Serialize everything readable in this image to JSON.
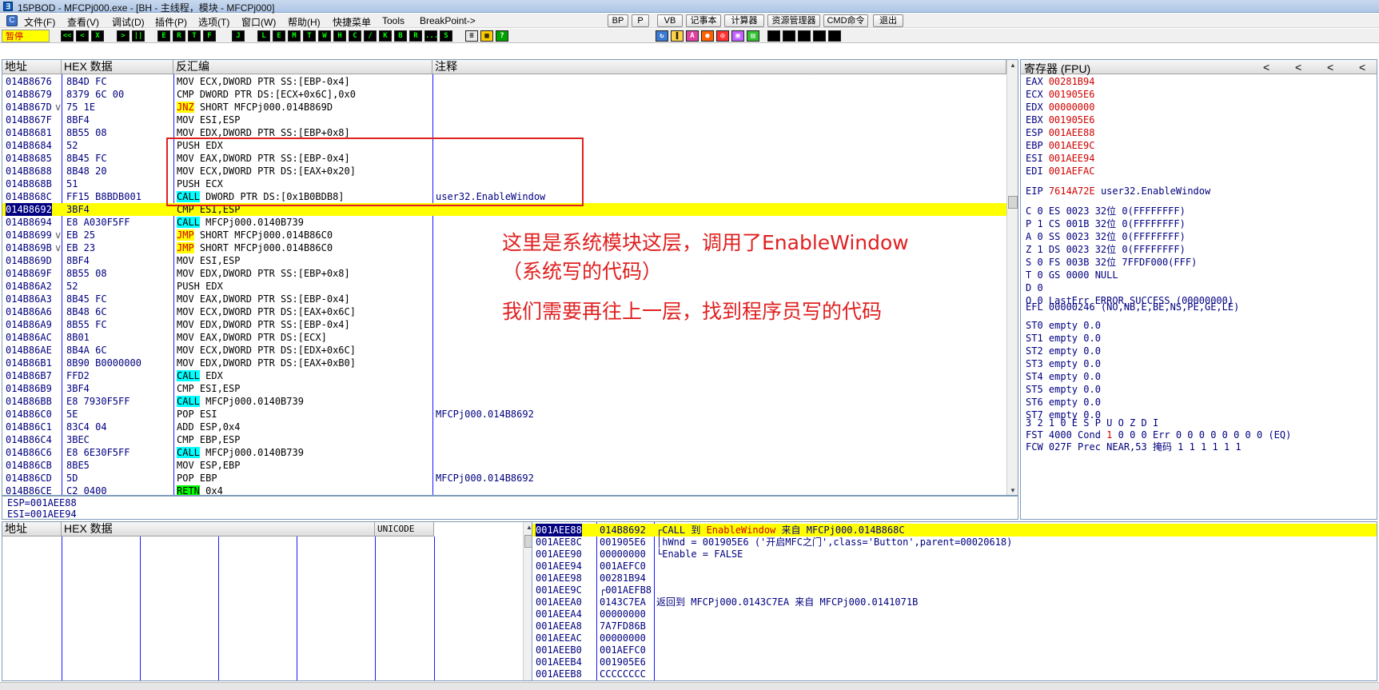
{
  "window": {
    "title": "15PBOD - MFCPj000.exe - [BH - 主线程，模块 - MFCPj000]",
    "icon": "debugger-app-icon"
  },
  "menu": {
    "items": [
      "文件(F)",
      "查看(V)",
      "调试(D)",
      "插件(P)",
      "选项(T)",
      "窗口(W)",
      "帮助(H)",
      "快捷菜单",
      "Tools",
      "BreakPoint->"
    ],
    "buttons": [
      "BP",
      "P",
      "VB",
      "记事本",
      "计算器",
      "资源管理器",
      "CMD命令",
      "退出"
    ]
  },
  "toolbar": {
    "status": "暂停",
    "icons": [
      "<<",
      "<",
      "X",
      ">",
      "||",
      "E",
      "R",
      "T",
      "F",
      "J",
      "L",
      "E",
      "M",
      "T",
      "W",
      "H",
      "C",
      "/",
      "K",
      "B",
      "R",
      "...",
      "S"
    ]
  },
  "disasm": {
    "headers": [
      "地址",
      "HEX 数据",
      "反汇编",
      "注释"
    ],
    "rows": [
      {
        "addr": "014B8676",
        "mark": "",
        "hex": "8B4D FC",
        "op": "",
        "asm": "MOV ECX,DWORD PTR SS:[EBP-0x4]",
        "cmt": ""
      },
      {
        "addr": "014B8679",
        "mark": "",
        "hex": "8379 6C 00",
        "op": "",
        "asm": "CMP DWORD PTR DS:[ECX+0x6C],0x0",
        "cmt": ""
      },
      {
        "addr": "014B867D",
        "mark": "v",
        "hex": "75 1E",
        "op": "JNZ",
        "asm": " SHORT MFCPj000.014B869D",
        "cmt": ""
      },
      {
        "addr": "014B867F",
        "mark": "",
        "hex": "8BF4",
        "op": "",
        "asm": "MOV ESI,ESP",
        "cmt": ""
      },
      {
        "addr": "014B8681",
        "mark": "",
        "hex": "8B55 08",
        "op": "",
        "asm": "MOV EDX,DWORD PTR SS:[EBP+0x8]",
        "cmt": ""
      },
      {
        "addr": "014B8684",
        "mark": "",
        "hex": "52",
        "op": "",
        "asm": "PUSH EDX",
        "cmt": ""
      },
      {
        "addr": "014B8685",
        "mark": "",
        "hex": "8B45 FC",
        "op": "",
        "asm": "MOV EAX,DWORD PTR SS:[EBP-0x4]",
        "cmt": ""
      },
      {
        "addr": "014B8688",
        "mark": "",
        "hex": "8B48 20",
        "op": "",
        "asm": "MOV ECX,DWORD PTR DS:[EAX+0x20]",
        "cmt": ""
      },
      {
        "addr": "014B868B",
        "mark": "",
        "hex": "51",
        "op": "",
        "asm": "PUSH ECX",
        "cmt": ""
      },
      {
        "addr": "014B868C",
        "mark": "",
        "hex": "FF15 B8BDB001",
        "op": "CALL",
        "asm": " DWORD PTR DS:[0x1B0BDB8]",
        "cmt": "user32.EnableWindow"
      },
      {
        "addr": "014B8692",
        "mark": "",
        "hex": "3BF4",
        "op": "",
        "asm": "CMP ESI,ESP",
        "cmt": ""
      },
      {
        "addr": "014B8694",
        "mark": "",
        "hex": "E8 A030F5FF",
        "op": "CALL",
        "asm": " MFCPj000.0140B739",
        "cmt": ""
      },
      {
        "addr": "014B8699",
        "mark": "v",
        "hex": "EB 25",
        "op": "JMP",
        "asm": " SHORT MFCPj000.014B86C0",
        "cmt": ""
      },
      {
        "addr": "014B869B",
        "mark": "v",
        "hex": "EB 23",
        "op": "JMP",
        "asm": " SHORT MFCPj000.014B86C0",
        "cmt": ""
      },
      {
        "addr": "014B869D",
        "mark": "",
        "hex": "8BF4",
        "op": "",
        "asm": "MOV ESI,ESP",
        "cmt": ""
      },
      {
        "addr": "014B869F",
        "mark": "",
        "hex": "8B55 08",
        "op": "",
        "asm": "MOV EDX,DWORD PTR SS:[EBP+0x8]",
        "cmt": ""
      },
      {
        "addr": "014B86A2",
        "mark": "",
        "hex": "52",
        "op": "",
        "asm": "PUSH EDX",
        "cmt": ""
      },
      {
        "addr": "014B86A3",
        "mark": "",
        "hex": "8B45 FC",
        "op": "",
        "asm": "MOV EAX,DWORD PTR SS:[EBP-0x4]",
        "cmt": ""
      },
      {
        "addr": "014B86A6",
        "mark": "",
        "hex": "8B48 6C",
        "op": "",
        "asm": "MOV ECX,DWORD PTR DS:[EAX+0x6C]",
        "cmt": ""
      },
      {
        "addr": "014B86A9",
        "mark": "",
        "hex": "8B55 FC",
        "op": "",
        "asm": "MOV EDX,DWORD PTR SS:[EBP-0x4]",
        "cmt": ""
      },
      {
        "addr": "014B86AC",
        "mark": "",
        "hex": "8B01",
        "op": "",
        "asm": "MOV EAX,DWORD PTR DS:[ECX]",
        "cmt": ""
      },
      {
        "addr": "014B86AE",
        "mark": "",
        "hex": "8B4A 6C",
        "op": "",
        "asm": "MOV ECX,DWORD PTR DS:[EDX+0x6C]",
        "cmt": ""
      },
      {
        "addr": "014B86B1",
        "mark": "",
        "hex": "8B90 B0000000",
        "op": "",
        "asm": "MOV EDX,DWORD PTR DS:[EAX+0xB0]",
        "cmt": ""
      },
      {
        "addr": "014B86B7",
        "mark": "",
        "hex": "FFD2",
        "op": "CALL",
        "asm": " EDX",
        "cmt": ""
      },
      {
        "addr": "014B86B9",
        "mark": "",
        "hex": "3BF4",
        "op": "",
        "asm": "CMP ESI,ESP",
        "cmt": ""
      },
      {
        "addr": "014B86BB",
        "mark": "",
        "hex": "E8 7930F5FF",
        "op": "CALL",
        "asm": " MFCPj000.0140B739",
        "cmt": ""
      },
      {
        "addr": "014B86C0",
        "mark": "",
        "hex": "5E",
        "op": "",
        "asm": "POP ESI",
        "cmt": "MFCPj000.014B8692"
      },
      {
        "addr": "014B86C1",
        "mark": "",
        "hex": "83C4 04",
        "op": "",
        "asm": "ADD ESP,0x4",
        "cmt": ""
      },
      {
        "addr": "014B86C4",
        "mark": "",
        "hex": "3BEC",
        "op": "",
        "asm": "CMP EBP,ESP",
        "cmt": ""
      },
      {
        "addr": "014B86C6",
        "mark": "",
        "hex": "E8 6E30F5FF",
        "op": "CALL",
        "asm": " MFCPj000.0140B739",
        "cmt": ""
      },
      {
        "addr": "014B86CB",
        "mark": "",
        "hex": "8BE5",
        "op": "",
        "asm": "MOV ESP,EBP",
        "cmt": ""
      },
      {
        "addr": "014B86CD",
        "mark": "",
        "hex": "5D",
        "op": "",
        "asm": "POP EBP",
        "cmt": "MFCPj000.014B8692"
      },
      {
        "addr": "014B86CE",
        "mark": "",
        "hex": "C2 0400",
        "op": "RETN",
        "asm": " 0x4",
        "cmt": ""
      }
    ],
    "current_row_index": 10
  },
  "annotation": {
    "line1": "这里是系统模块这层，调用了EnableWindow",
    "line2": "（系统写的代码）",
    "line3": "我们需要再往上一层，找到程序员写的代码"
  },
  "info": {
    "line1": "ESP=001AEE88",
    "line2": "ESI=001AEE94"
  },
  "registers": {
    "title": "寄存器 (FPU)",
    "nav": [
      "<",
      "<",
      "<",
      "<"
    ],
    "general": [
      {
        "name": "EAX",
        "value": "00281B94"
      },
      {
        "name": "ECX",
        "value": "001905E6"
      },
      {
        "name": "EDX",
        "value": "00000000"
      },
      {
        "name": "EBX",
        "value": "001905E6"
      },
      {
        "name": "ESP",
        "value": "001AEE88"
      },
      {
        "name": "EBP",
        "value": "001AEE9C"
      },
      {
        "name": "ESI",
        "value": "001AEE94"
      },
      {
        "name": "EDI",
        "value": "001AEFAC"
      }
    ],
    "eip": {
      "name": "EIP",
      "value": "7614A72E",
      "sym": "user32.EnableWindow"
    },
    "flags": [
      "C 0  ES 0023 32位 0(FFFFFFFF)",
      "P 1  CS 001B 32位 0(FFFFFFFF)",
      "A 0  SS 0023 32位 0(FFFFFFFF)",
      "Z 1  DS 0023 32位 0(FFFFFFFF)",
      "S 0  FS 003B 32位 7FFDF000(FFF)",
      "T 0  GS 0000 NULL",
      "D 0",
      "O 0  LastErr ERROR_SUCCESS (00000000)"
    ],
    "efl": "EFL 00000246 (NO,NB,E,BE,NS,PE,GE,LE)",
    "fpu": [
      "ST0 empty 0.0",
      "ST1 empty 0.0",
      "ST2 empty 0.0",
      "ST3 empty 0.0",
      "ST4 empty 0.0",
      "ST5 empty 0.0",
      "ST6 empty 0.0",
      "ST7 empty 0.0"
    ],
    "fst_header": "               3 2 1 0      E S P U O Z D I",
    "fst_label": "FST 4000  Cond ",
    "fst_red": "1",
    "fst_rest": " 0 0 0  Err 0 0 0 0 0 0 0 0  (EQ)",
    "fcw": "FCW 027F  Prec NEAR,53  掩码    1 1 1 1 1 1"
  },
  "dump": {
    "headers": [
      "地址",
      "HEX 数据",
      "UNICODE"
    ]
  },
  "stack": {
    "rows": [
      {
        "addr": "001AEE88",
        "val": "014B8692",
        "cmt_prefix": "┌CALL 到 ",
        "cmt_red": "EnableWindow",
        "cmt_suffix": " 来自 MFCPj000.014B868C"
      },
      {
        "addr": "001AEE8C",
        "val": "001905E6",
        "cmt_prefix": "│hWnd = 001905E6 ('开启MFC之门',class='Button',parent=00020618)",
        "cmt_red": "",
        "cmt_suffix": ""
      },
      {
        "addr": "001AEE90",
        "val": "00000000",
        "cmt_prefix": "└Enable = FALSE",
        "cmt_red": "",
        "cmt_suffix": ""
      },
      {
        "addr": "001AEE94",
        "val": "001AEFC0",
        "cmt_prefix": "",
        "cmt_red": "",
        "cmt_suffix": ""
      },
      {
        "addr": "001AEE98",
        "val": "00281B94",
        "cmt_prefix": "",
        "cmt_red": "",
        "cmt_suffix": ""
      },
      {
        "addr": "001AEE9C",
        "val": "┌001AEFB8",
        "cmt_prefix": "",
        "cmt_red": "",
        "cmt_suffix": ""
      },
      {
        "addr": "001AEEA0",
        "val": "0143C7EA",
        "cmt_prefix": "返回到 MFCPj000.0143C7EA 来自 MFCPj000.0141071B",
        "cmt_red": "",
        "cmt_suffix": ""
      },
      {
        "addr": "001AEEA4",
        "val": "00000000",
        "cmt_prefix": "",
        "cmt_red": "",
        "cmt_suffix": ""
      },
      {
        "addr": "001AEEA8",
        "val": "7A7FD86B",
        "cmt_prefix": "",
        "cmt_red": "",
        "cmt_suffix": ""
      },
      {
        "addr": "001AEEAC",
        "val": "00000000",
        "cmt_prefix": "",
        "cmt_red": "",
        "cmt_suffix": ""
      },
      {
        "addr": "001AEEB0",
        "val": "001AEFC0",
        "cmt_prefix": "",
        "cmt_red": "",
        "cmt_suffix": ""
      },
      {
        "addr": "001AEEB4",
        "val": "001905E6",
        "cmt_prefix": "",
        "cmt_red": "",
        "cmt_suffix": ""
      },
      {
        "addr": "001AEEB8",
        "val": "CCCCCCCC",
        "cmt_prefix": "",
        "cmt_red": "",
        "cmt_suffix": ""
      }
    ]
  },
  "colors": {
    "current_line": "#ffff00",
    "call_bg": "#00ffff",
    "jmp_fg": "#d00000",
    "annotation": "#e02020",
    "text_blue": "#000080"
  }
}
